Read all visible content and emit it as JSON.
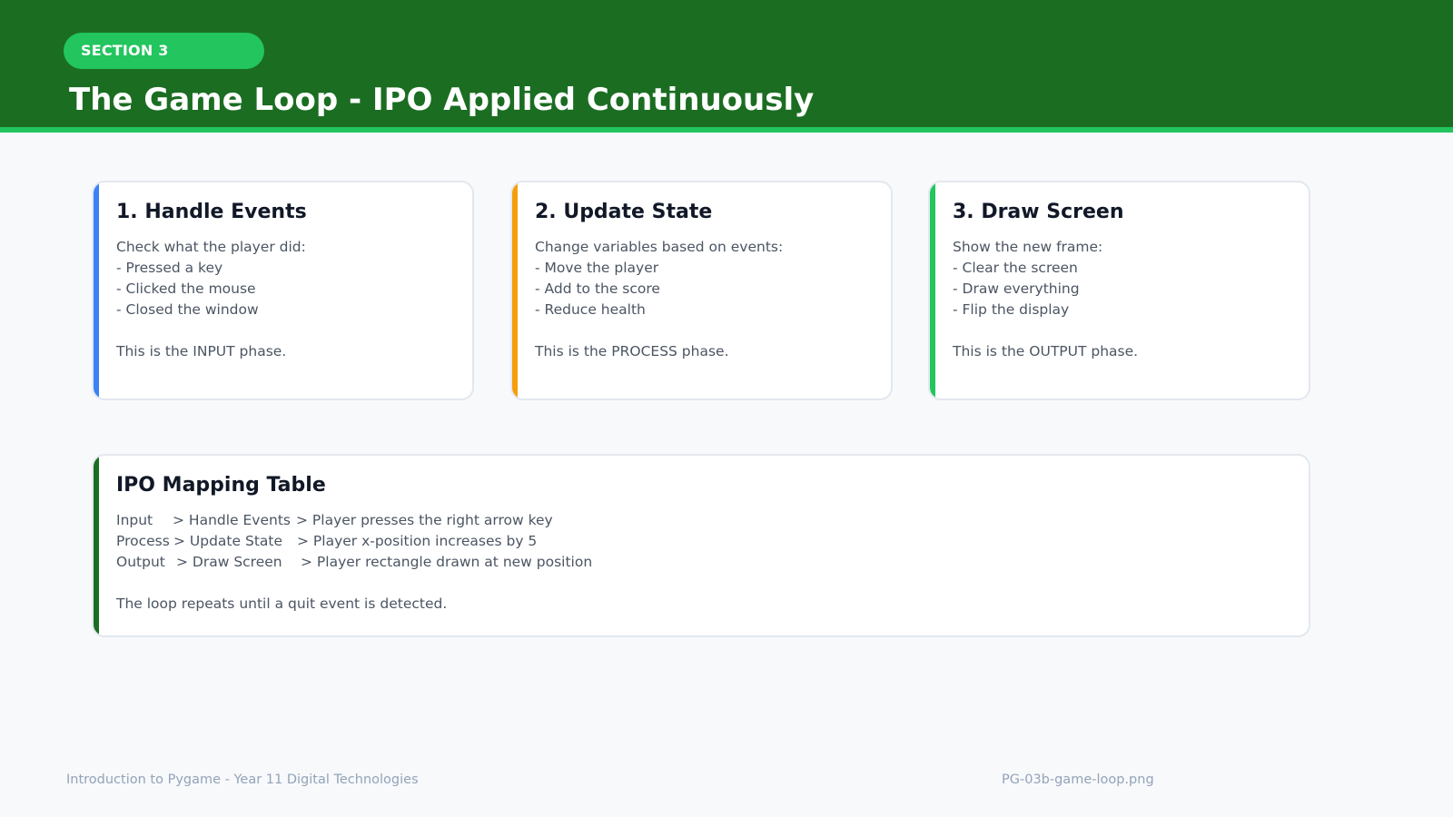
{
  "header": {
    "section_label": "SECTION 3",
    "title": "The Game Loop - IPO Applied Continuously"
  },
  "cards": [
    {
      "title": "1. Handle Events",
      "accent": "#3b82f6",
      "intro": "Check what the player did:",
      "items": [
        "- Pressed a key",
        "- Clicked the mouse",
        "- Closed the window"
      ],
      "phase": "This is the INPUT phase."
    },
    {
      "title": "2. Update State",
      "accent": "#f59e0b",
      "intro": "Change variables based on events:",
      "items": [
        "- Move the player",
        "- Add to the score",
        "- Reduce health"
      ],
      "phase": "This is the PROCESS phase."
    },
    {
      "title": "3. Draw Screen",
      "accent": "#22c55e",
      "intro": "Show the new frame:",
      "items": [
        "- Clear the screen",
        "- Draw everything",
        "- Flip the display"
      ],
      "phase": "This is the OUTPUT phase."
    }
  ],
  "mapping": {
    "title": "IPO Mapping Table",
    "accent": "#1b6d22",
    "rows": [
      {
        "ipo": "Input",
        "step": "> Handle Events",
        "example": "> Player presses the right arrow key"
      },
      {
        "ipo": "Process",
        "step": "> Update State",
        "example": "> Player x-position increases by 5"
      },
      {
        "ipo": "Output",
        "step": "> Draw Screen",
        "example": "> Player rectangle drawn at new position"
      }
    ],
    "note": "The loop repeats until a quit event is detected."
  },
  "footer": {
    "course": "Introduction to Pygame - Year 11 Digital Technologies",
    "filename": "PG-03b-game-loop.png"
  },
  "colors": {
    "header_bg": "#1b6d22",
    "header_rule": "#22c55e",
    "section_pill": "#22c55e",
    "page_bg": "#f7f9fb"
  }
}
